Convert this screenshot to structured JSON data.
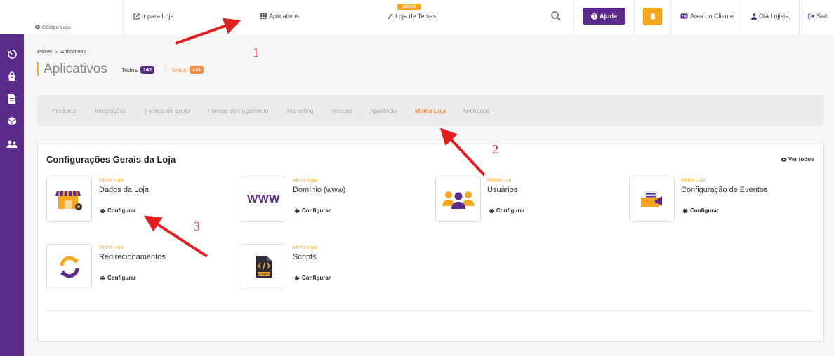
{
  "header": {
    "store_code": "Código Loja:",
    "nav": {
      "ir_para_loja": "Ir para Loja",
      "aplicativos": "Aplicativos",
      "loja_de_temas": "Loja de Temas",
      "novo_badge": "NOVO"
    },
    "help_label": "Ajuda",
    "area_cliente": "Área do Cliente",
    "ola_lojista": "Olá Lojista,",
    "sair": "Sair"
  },
  "breadcrumb": {
    "root": "Painel",
    "separator": "›",
    "current": "Aplicativos"
  },
  "page": {
    "title": "Aplicativos",
    "filters": {
      "todos_label": "Todos",
      "todos_count": "142",
      "meus_label": "Meus",
      "meus_count": "141"
    }
  },
  "categories": [
    "Produtos",
    "Integrações",
    "Formas de Envio",
    "Formas de Pagamento",
    "Marketing",
    "Vendas",
    "Aparência",
    "Minha Loja",
    "Antifraude"
  ],
  "active_category": "Minha Loja",
  "section": {
    "title": "Configurações Gerais da Loja",
    "ver_todos": "Ver todos",
    "apps": [
      {
        "category": "Minha Loja",
        "name": "Dados da Loja",
        "action": "Configurar",
        "icon": "store-settings-icon"
      },
      {
        "category": "Minha Loja",
        "name": "Domínio (www)",
        "action": "Configurar",
        "icon": "www-icon"
      },
      {
        "category": "Minha Loja",
        "name": "Usuários",
        "action": "Configurar",
        "icon": "users-group-icon"
      },
      {
        "category": "Minha Loja",
        "name": "Configuração de Eventos",
        "action": "Configurar",
        "icon": "events-megaphone-icon"
      },
      {
        "category": "Minha Loja",
        "name": "Redirecionamentos",
        "action": "Configurar",
        "icon": "redirect-cycle-icon"
      },
      {
        "category": "Minha Loja",
        "name": "Scripts",
        "action": "Configurar",
        "icon": "script-file-icon"
      }
    ]
  },
  "www_text": "WWW",
  "script_label": "SCRIPTS",
  "annotations": [
    "1",
    "2",
    "3"
  ],
  "colors": {
    "primary": "#5b2b8c",
    "accent": "#f6a623",
    "active_tab": "#f68b3c",
    "annotation": "#d32f2f"
  }
}
